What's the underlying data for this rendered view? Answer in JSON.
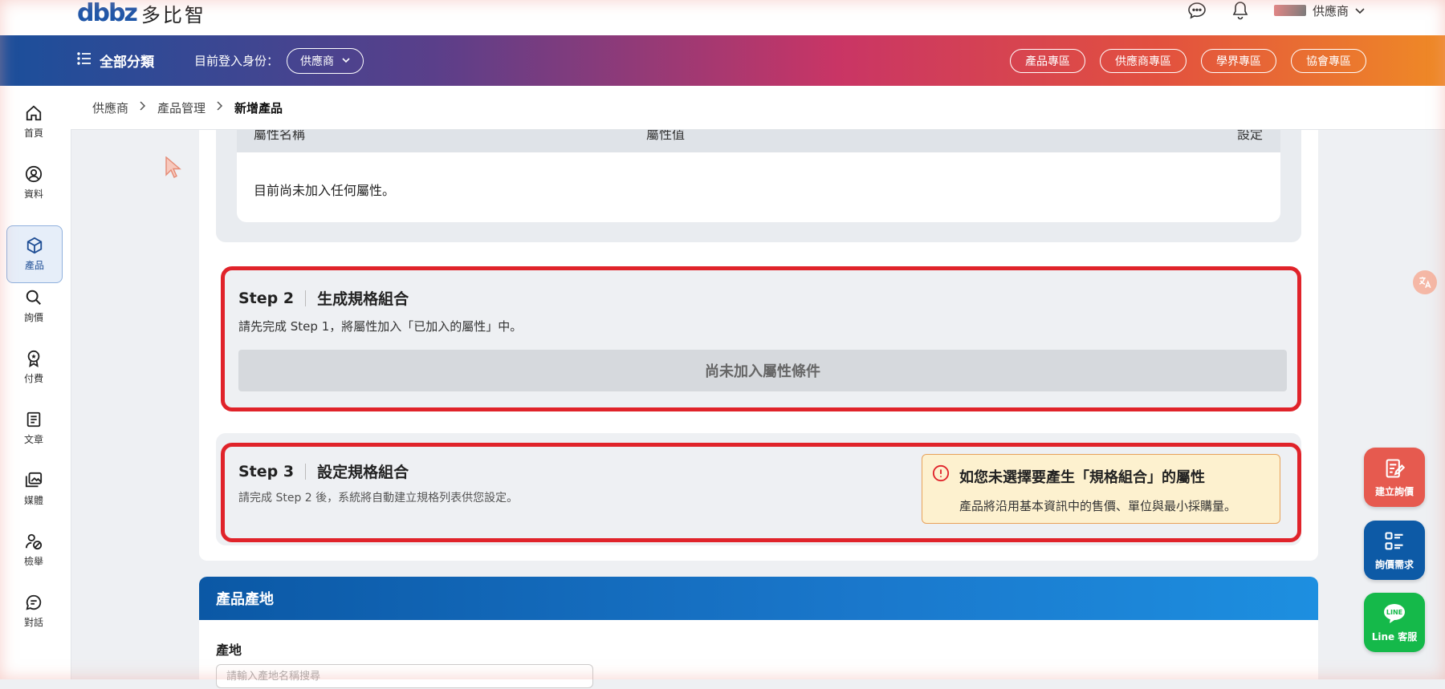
{
  "brand": {
    "logo_mark": "dbbz",
    "logo_text": "多比智"
  },
  "topbar": {
    "user_name": "供應商"
  },
  "banner": {
    "all_categories": "全部分類",
    "login_identity_label": "目前登入身份：",
    "role": "供應商",
    "zones": [
      "產品專區",
      "供應商專區",
      "學界專區",
      "協會專區"
    ]
  },
  "sidebar": {
    "items": [
      {
        "label": "首頁",
        "icon": "home-icon"
      },
      {
        "label": "資料",
        "icon": "user-circle-icon"
      },
      {
        "label": "產品",
        "icon": "box-icon"
      },
      {
        "label": "詢價",
        "icon": "search-icon"
      },
      {
        "label": "付費",
        "icon": "award-icon"
      },
      {
        "label": "文章",
        "icon": "document-icon"
      },
      {
        "label": "媒體",
        "icon": "media-icon"
      },
      {
        "label": "檢舉",
        "icon": "report-icon"
      },
      {
        "label": "對話",
        "icon": "chat-icon"
      }
    ]
  },
  "breadcrumb": {
    "items": [
      "供應商",
      "產品管理",
      "新增產品"
    ]
  },
  "attributes": {
    "columns": [
      "屬性名稱",
      "屬性值",
      "設定"
    ],
    "empty_message": "目前尚未加入任何屬性。"
  },
  "step2": {
    "step": "Step 2",
    "title": "生成規格組合",
    "description": "請先完成 Step 1，將屬性加入「已加入的屬性」中。",
    "pending": "尚未加入屬性條件"
  },
  "step3": {
    "step": "Step 3",
    "title": "設定規格組合",
    "description": "請完成 Step 2 後，系統將自動建立規格列表供您設定。"
  },
  "warning": {
    "title": "如您未選擇要產生「規格組合」的屬性",
    "text": "產品將沿用基本資訊中的售價、單位與最小採購量。"
  },
  "origin": {
    "section_title": "產品產地",
    "field_label": "產地",
    "placeholder": "請輸入產地名稱搜尋"
  },
  "fabs": {
    "create_inquiry": "建立詢價",
    "inquiry_needs": "詢價需求",
    "line_service": "Line 客服"
  },
  "colors": {
    "accent_red": "#e0232a",
    "brand_blue": "#0b58a5",
    "line_green": "#15b94a"
  }
}
